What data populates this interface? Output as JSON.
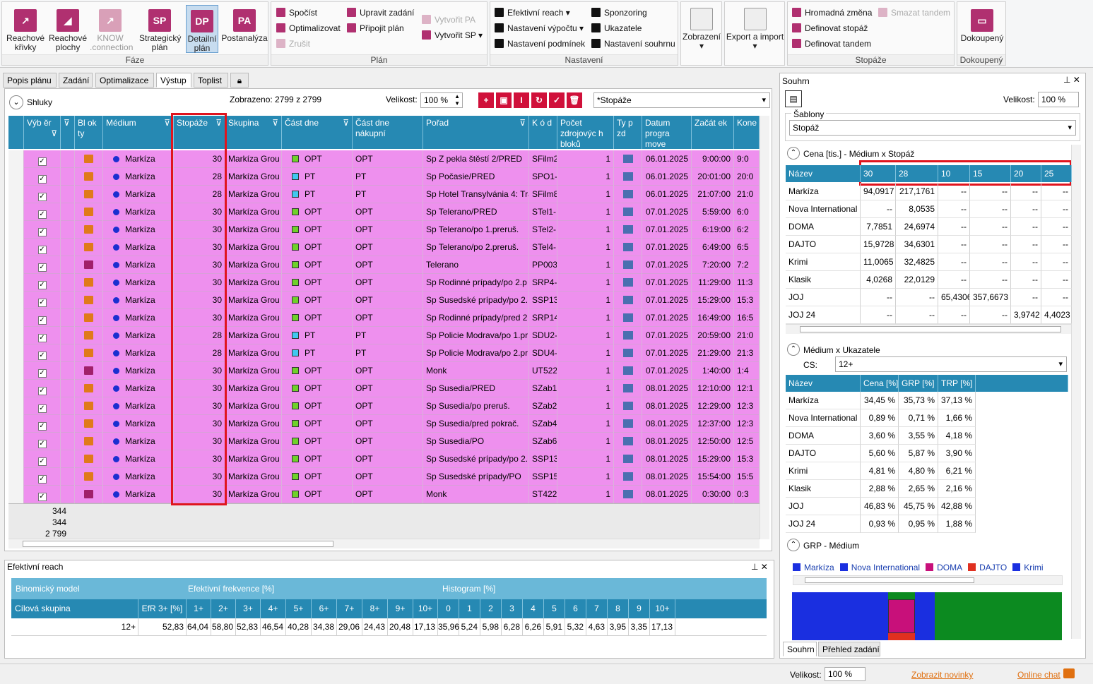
{
  "ribbon": {
    "faze": {
      "label": "Fáze",
      "buttons": [
        {
          "label": "Reachové křivky",
          "icon": "reach-curves-icon"
        },
        {
          "label": "Reachové plochy",
          "icon": "reach-areas-icon"
        },
        {
          "label": "KNOW .connection",
          "icon": "know-connection-icon",
          "disabled": true
        },
        {
          "label": "Strategický plán",
          "short": "SP"
        },
        {
          "label": "Detailní plán",
          "short": "DP",
          "selected": true
        },
        {
          "label": "Postanalýza",
          "short": "PA"
        }
      ]
    },
    "plan": {
      "label": "Plán",
      "items": [
        "Spočíst",
        "Optimalizovat",
        "Zrušit",
        "Upravit zadání",
        "Připojit plán",
        "Vytvořit PA",
        "Vytvořit SP"
      ]
    },
    "nastaveni": {
      "label": "Nastavení",
      "items": [
        "Efektivní reach",
        "Nastavení výpočtu",
        "Nastavení podmínek",
        "Sponzoring",
        "Ukazatele",
        "Nastavení souhrnu"
      ]
    },
    "zobrazeni": "Zobrazení",
    "export": "Export a import",
    "stopaze": {
      "label": "Stopáže",
      "items": [
        "Hromadná změna",
        "Definovat stopáž",
        "Definovat tandem",
        "Smazat tandem"
      ]
    },
    "dokoupeny": {
      "label": "Dokoupený",
      "button": "Dokoupený"
    }
  },
  "tabs": [
    "Popis plánu",
    "Zadání",
    "Optimalizace",
    "Výstup",
    "Toplist"
  ],
  "grid": {
    "shluky": "Shluky",
    "displayed": "Zobrazeno: 2799 z 2799",
    "size_label": "Velikost:",
    "size_value": "100 %",
    "view_select": "*Stopáže",
    "headers": [
      "Výb ěr",
      "Bl ok ty",
      "Médium",
      "Stopáže",
      "Skupina",
      "Část dne",
      "Část dne nákupní",
      "Pořad",
      "K ó d",
      "Počet zdrojovýc h bloků",
      "Ty p zd",
      "Datum progra move",
      "Začát ek",
      "Kone"
    ],
    "rows": [
      {
        "blk": "o",
        "medium": "Markíza",
        "stopaz": "30",
        "skupina": "Markíza Grou",
        "cast": "OPT",
        "col": "#6fd12a",
        "nakup": "OPT",
        "porad": "Sp Z pekla štěstí 2/PRED",
        "kod": "SFilm2",
        "pocet": "1",
        "datum": "06.01.2025",
        "zacatek": "9:00:00",
        "konec": "9:0"
      },
      {
        "blk": "o",
        "medium": "Markíza",
        "stopaz": "28",
        "skupina": "Markíza Grou",
        "cast": "PT",
        "col": "#40c8f0",
        "nakup": "PT",
        "porad": "Sp Počasie/PRED",
        "kod": "SPO1-",
        "pocet": "1",
        "datum": "06.01.2025",
        "zacatek": "20:01:00",
        "konec": "20:0"
      },
      {
        "blk": "o",
        "medium": "Markíza",
        "stopaz": "28",
        "skupina": "Markíza Grou",
        "cast": "PT",
        "col": "#40c8f0",
        "nakup": "PT",
        "porad": "Sp Hotel Transylvánia 4: Tra",
        "kod": "SFilm8",
        "pocet": "1",
        "datum": "06.01.2025",
        "zacatek": "21:07:00",
        "konec": "21:0"
      },
      {
        "blk": "o",
        "medium": "Markíza",
        "stopaz": "30",
        "skupina": "Markíza Grou",
        "cast": "OPT",
        "col": "#6fd12a",
        "nakup": "OPT",
        "porad": "Sp Telerano/PRED",
        "kod": "STel1-",
        "pocet": "1",
        "datum": "07.01.2025",
        "zacatek": "5:59:00",
        "konec": "6:0"
      },
      {
        "blk": "o",
        "medium": "Markíza",
        "stopaz": "30",
        "skupina": "Markíza Grou",
        "cast": "OPT",
        "col": "#6fd12a",
        "nakup": "OPT",
        "porad": "Sp Telerano/po 1.preruš.",
        "kod": "STel2-",
        "pocet": "1",
        "datum": "07.01.2025",
        "zacatek": "6:19:00",
        "konec": "6:2"
      },
      {
        "blk": "o",
        "medium": "Markíza",
        "stopaz": "30",
        "skupina": "Markíza Grou",
        "cast": "OPT",
        "col": "#6fd12a",
        "nakup": "OPT",
        "porad": "Sp Telerano/po 2.preruš.",
        "kod": "STel4-",
        "pocet": "1",
        "datum": "07.01.2025",
        "zacatek": "6:49:00",
        "konec": "6:5"
      },
      {
        "blk": "p",
        "medium": "Markíza",
        "stopaz": "30",
        "skupina": "Markíza Grou",
        "cast": "OPT",
        "col": "#6fd12a",
        "nakup": "OPT",
        "porad": "Telerano",
        "kod": "PP003",
        "pocet": "1",
        "datum": "07.01.2025",
        "zacatek": "7:20:00",
        "konec": "7:2"
      },
      {
        "blk": "o",
        "medium": "Markíza",
        "stopaz": "30",
        "skupina": "Markíza Grou",
        "cast": "OPT",
        "col": "#6fd12a",
        "nakup": "OPT",
        "porad": "Sp Rodinné prípady/po 2.p",
        "kod": "SRP4-",
        "pocet": "1",
        "datum": "07.01.2025",
        "zacatek": "11:29:00",
        "konec": "11:3"
      },
      {
        "blk": "o",
        "medium": "Markíza",
        "stopaz": "30",
        "skupina": "Markíza Grou",
        "cast": "OPT",
        "col": "#6fd12a",
        "nakup": "OPT",
        "porad": "Sp Susedské prípady/po 2.",
        "kod": "SSP13",
        "pocet": "1",
        "datum": "07.01.2025",
        "zacatek": "15:29:00",
        "konec": "15:3"
      },
      {
        "blk": "o",
        "medium": "Markíza",
        "stopaz": "30",
        "skupina": "Markíza Grou",
        "cast": "OPT",
        "col": "#6fd12a",
        "nakup": "OPT",
        "porad": "Sp Rodinné prípady/pred 2",
        "kod": "SRP14",
        "pocet": "1",
        "datum": "07.01.2025",
        "zacatek": "16:49:00",
        "konec": "16:5"
      },
      {
        "blk": "o",
        "medium": "Markíza",
        "stopaz": "28",
        "skupina": "Markíza Grou",
        "cast": "PT",
        "col": "#40c8f0",
        "nakup": "PT",
        "porad": "Sp Policie Modrava/po 1.pr",
        "kod": "SDU2-",
        "pocet": "1",
        "datum": "07.01.2025",
        "zacatek": "20:59:00",
        "konec": "21:0"
      },
      {
        "blk": "o",
        "medium": "Markíza",
        "stopaz": "28",
        "skupina": "Markíza Grou",
        "cast": "PT",
        "col": "#40c8f0",
        "nakup": "PT",
        "porad": "Sp Policie Modrava/po 2.pr",
        "kod": "SDU4-",
        "pocet": "1",
        "datum": "07.01.2025",
        "zacatek": "21:29:00",
        "konec": "21:3"
      },
      {
        "blk": "p",
        "medium": "Markíza",
        "stopaz": "30",
        "skupina": "Markíza Grou",
        "cast": "OPT",
        "col": "#6fd12a",
        "nakup": "OPT",
        "porad": "Monk",
        "kod": "UT522",
        "pocet": "1",
        "datum": "07.01.2025",
        "zacatek": "1:40:00",
        "konec": "1:4"
      },
      {
        "blk": "o",
        "medium": "Markíza",
        "stopaz": "30",
        "skupina": "Markíza Grou",
        "cast": "OPT",
        "col": "#6fd12a",
        "nakup": "OPT",
        "porad": "Sp Susedia/PRED",
        "kod": "SZab1",
        "pocet": "1",
        "datum": "08.01.2025",
        "zacatek": "12:10:00",
        "konec": "12:1"
      },
      {
        "blk": "o",
        "medium": "Markíza",
        "stopaz": "30",
        "skupina": "Markíza Grou",
        "cast": "OPT",
        "col": "#6fd12a",
        "nakup": "OPT",
        "porad": "Sp Susedia/po preruš.",
        "kod": "SZab2",
        "pocet": "1",
        "datum": "08.01.2025",
        "zacatek": "12:29:00",
        "konec": "12:3"
      },
      {
        "blk": "o",
        "medium": "Markíza",
        "stopaz": "30",
        "skupina": "Markíza Grou",
        "cast": "OPT",
        "col": "#6fd12a",
        "nakup": "OPT",
        "porad": "Sp Susedia/pred pokrač.",
        "kod": "SZab4",
        "pocet": "1",
        "datum": "08.01.2025",
        "zacatek": "12:37:00",
        "konec": "12:3"
      },
      {
        "blk": "o",
        "medium": "Markíza",
        "stopaz": "30",
        "skupina": "Markíza Grou",
        "cast": "OPT",
        "col": "#6fd12a",
        "nakup": "OPT",
        "porad": "Sp Susedia/PO",
        "kod": "SZab6",
        "pocet": "1",
        "datum": "08.01.2025",
        "zacatek": "12:50:00",
        "konec": "12:5"
      },
      {
        "blk": "o",
        "medium": "Markíza",
        "stopaz": "30",
        "skupina": "Markíza Grou",
        "cast": "OPT",
        "col": "#6fd12a",
        "nakup": "OPT",
        "porad": "Sp Susedské prípady/po 2.",
        "kod": "SSP13",
        "pocet": "1",
        "datum": "08.01.2025",
        "zacatek": "15:29:00",
        "konec": "15:3"
      },
      {
        "blk": "o",
        "medium": "Markíza",
        "stopaz": "30",
        "skupina": "Markíza Grou",
        "cast": "OPT",
        "col": "#6fd12a",
        "nakup": "OPT",
        "porad": "Sp Susedské prípady/PO",
        "kod": "SSP15",
        "pocet": "1",
        "datum": "08.01.2025",
        "zacatek": "15:54:00",
        "konec": "15:5"
      },
      {
        "blk": "p",
        "medium": "Markíza",
        "stopaz": "30",
        "skupina": "Markíza Grou",
        "cast": "OPT",
        "col": "#6fd12a",
        "nakup": "OPT",
        "porad": "Monk",
        "kod": "ST422",
        "pocet": "1",
        "datum": "08.01.2025",
        "zacatek": "0:30:00",
        "konec": "0:3"
      }
    ],
    "footer": [
      "344",
      "344",
      "2 799"
    ]
  },
  "efreach": {
    "title": "Efektivní reach",
    "g1": "Binomický model",
    "g2": "Efektivní frekvence [%]",
    "g3": "Histogram [%]",
    "cols": [
      "Cílová skupina",
      "EfR 3+ [%]",
      "1+",
      "2+",
      "3+",
      "4+",
      "5+",
      "6+",
      "7+",
      "8+",
      "9+",
      "10+",
      "0",
      "1",
      "2",
      "3",
      "4",
      "5",
      "6",
      "7",
      "8",
      "9",
      "10+"
    ],
    "row": [
      "12+",
      "52,83",
      "64,04",
      "58,80",
      "52,83",
      "46,54",
      "40,28",
      "34,38",
      "29,06",
      "24,43",
      "20,48",
      "17,13",
      "35,96",
      "5,24",
      "5,98",
      "6,28",
      "6,26",
      "5,91",
      "5,32",
      "4,63",
      "3,95",
      "3,35",
      "17,13"
    ]
  },
  "summary": {
    "title": "Souhrn",
    "size_label": "Velikost:",
    "size_value": "100 %",
    "templates_label": "Šablony",
    "template": "Stopáž",
    "sec1": "Cena [tis.] - Médium x Stopáž",
    "t1_head": [
      "Název",
      "30",
      "28",
      "10",
      "15",
      "20",
      "25"
    ],
    "t1_rows": [
      [
        "Markíza",
        "94,0917",
        "217,1761",
        "--",
        "--",
        "--",
        "--"
      ],
      [
        "Nova International",
        "--",
        "8,0535",
        "--",
        "--",
        "--",
        "--"
      ],
      [
        "DOMA",
        "7,7851",
        "24,6974",
        "--",
        "--",
        "--",
        "--"
      ],
      [
        "DAJTO",
        "15,9728",
        "34,6301",
        "--",
        "--",
        "--",
        "--"
      ],
      [
        "Krimi",
        "11,0065",
        "32,4825",
        "--",
        "--",
        "--",
        "--"
      ],
      [
        "Klasik",
        "4,0268",
        "22,0129",
        "--",
        "--",
        "--",
        "--"
      ],
      [
        "JOJ",
        "--",
        "--",
        "65,4306",
        "357,6673",
        "--",
        "--"
      ],
      [
        "JOJ 24",
        "--",
        "--",
        "--",
        "--",
        "3,9742",
        "4,4023"
      ]
    ],
    "sec2": "Médium x Ukazatele",
    "cs_label": "CS:",
    "cs_value": "12+",
    "t2_head": [
      "Název",
      "Cena [%]",
      "GRP [%]",
      "TRP [%]"
    ],
    "t2_rows": [
      [
        "Markíza",
        "34,45 %",
        "35,73 %",
        "37,13 %"
      ],
      [
        "Nova International",
        "0,89 %",
        "0,71 %",
        "1,66 %"
      ],
      [
        "DOMA",
        "3,60 %",
        "3,55 %",
        "4,18 %"
      ],
      [
        "DAJTO",
        "5,60 %",
        "5,87 %",
        "3,90 %"
      ],
      [
        "Krimi",
        "4,81 %",
        "4,80 %",
        "6,21 %"
      ],
      [
        "Klasik",
        "2,88 %",
        "2,65 %",
        "2,16 %"
      ],
      [
        "JOJ",
        "46,83 %",
        "45,75 %",
        "42,88 %"
      ],
      [
        "JOJ 24",
        "0,93 %",
        "0,95 %",
        "1,88 %"
      ]
    ],
    "sec3": "GRP - Médium",
    "legend": [
      {
        "name": "Markíza",
        "color": "#1a2fe0"
      },
      {
        "name": "Nova International",
        "color": "#1a2fe0"
      },
      {
        "name": "DOMA",
        "color": "#c8107a"
      },
      {
        "name": "DAJTO",
        "color": "#e03020"
      },
      {
        "name": "Krimi",
        "color": "#1a2fe0"
      }
    ],
    "bottom_tabs": [
      "Souhrn",
      "Přehled zadání"
    ]
  },
  "status": {
    "size_label": "Velikost:",
    "size_value": "100 %",
    "news": "Zobrazit novinky",
    "chat": "Online chat"
  }
}
